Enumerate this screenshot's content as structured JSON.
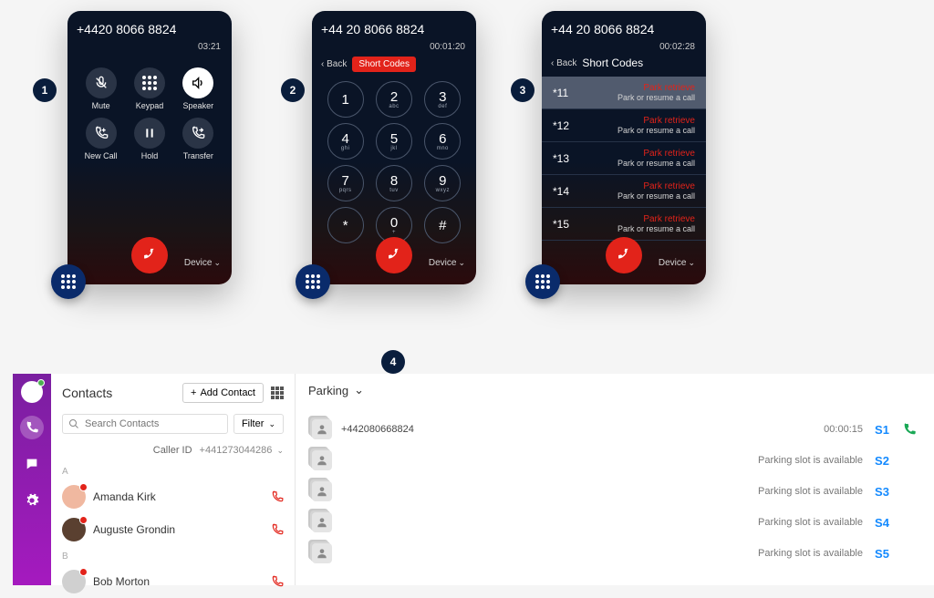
{
  "steps": {
    "s1": "1",
    "s2": "2",
    "s3": "3",
    "s4": "4"
  },
  "phone1": {
    "number": "+4420 8066 8824",
    "timer": "03:21",
    "actions": {
      "mute": "Mute",
      "keypad": "Keypad",
      "speaker": "Speaker",
      "newcall": "New Call",
      "hold": "Hold",
      "transfer": "Transfer"
    },
    "device": "Device"
  },
  "phone2": {
    "number": "+44 20 8066 8824",
    "timer": "00:01:20",
    "back": "Back",
    "short_codes": "Short Codes",
    "keys": [
      {
        "d": "1",
        "s": ""
      },
      {
        "d": "2",
        "s": "abc"
      },
      {
        "d": "3",
        "s": "def"
      },
      {
        "d": "4",
        "s": "ghi"
      },
      {
        "d": "5",
        "s": "jkl"
      },
      {
        "d": "6",
        "s": "mno"
      },
      {
        "d": "7",
        "s": "pqrs"
      },
      {
        "d": "8",
        "s": "tuv"
      },
      {
        "d": "9",
        "s": "wxyz"
      },
      {
        "d": "*",
        "s": ""
      },
      {
        "d": "0",
        "s": "+"
      },
      {
        "d": "#",
        "s": ""
      }
    ],
    "device": "Device"
  },
  "phone3": {
    "number": "+44 20 8066 8824",
    "timer": "00:02:28",
    "back": "Back",
    "title": "Short Codes",
    "items": [
      {
        "code": "*11",
        "top": "Park retrieve",
        "bot": "Park or resume a call",
        "sel": true
      },
      {
        "code": "*12",
        "top": "Park retrieve",
        "bot": "Park or resume a call",
        "sel": false
      },
      {
        "code": "*13",
        "top": "Park retrieve",
        "bot": "Park or resume a call",
        "sel": false
      },
      {
        "code": "*14",
        "top": "Park retrieve",
        "bot": "Park or resume a call",
        "sel": false
      },
      {
        "code": "*15",
        "top": "Park retrieve",
        "bot": "Park or resume a call",
        "sel": false
      }
    ],
    "device": "Device"
  },
  "contacts": {
    "title": "Contacts",
    "add": "Add Contact",
    "search_placeholder": "Search Contacts",
    "filter": "Filter",
    "caller_id_label": "Caller ID",
    "caller_id_value": "+441273044286",
    "sections": {
      "A": [
        {
          "name": "Amanda Kirk",
          "avatar_color": "#f0b8a0"
        },
        {
          "name": "Auguste Grondin",
          "avatar_color": "#5a4030"
        }
      ],
      "B": [
        {
          "name": "Bob Morton",
          "avatar_color": "#d0d0d0"
        }
      ]
    }
  },
  "parking": {
    "title": "Parking",
    "slots": [
      {
        "id": "S1",
        "text": "+442080668824",
        "status": "",
        "timer": "00:00:15",
        "occupied": true
      },
      {
        "id": "S2",
        "text": "",
        "status": "Parking slot is available",
        "timer": "",
        "occupied": false
      },
      {
        "id": "S3",
        "text": "",
        "status": "Parking slot is available",
        "timer": "",
        "occupied": false
      },
      {
        "id": "S4",
        "text": "",
        "status": "Parking slot is available",
        "timer": "",
        "occupied": false
      },
      {
        "id": "S5",
        "text": "",
        "status": "Parking slot is available",
        "timer": "",
        "occupied": false
      }
    ]
  }
}
